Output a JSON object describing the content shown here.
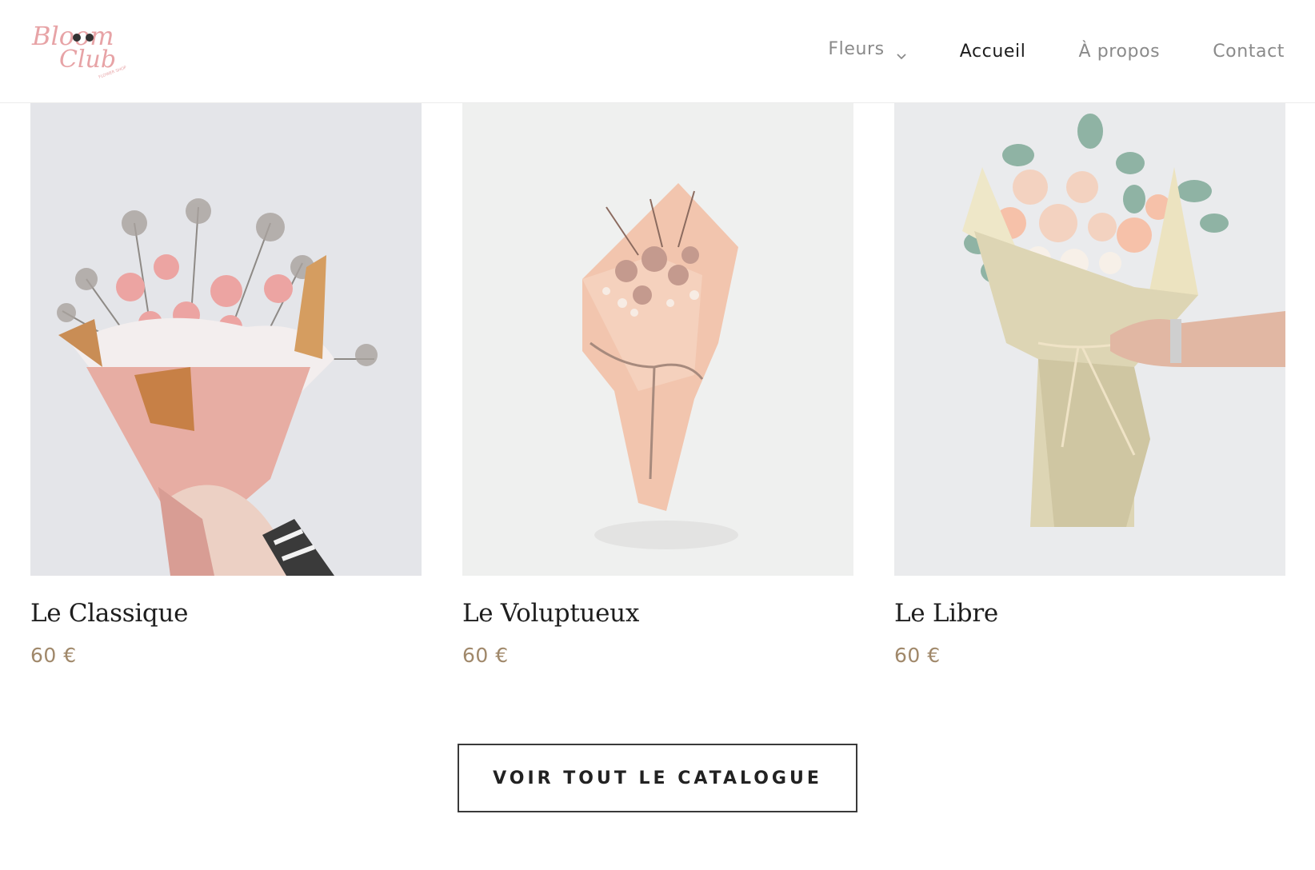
{
  "brand": {
    "logo_text_top": "Bloom",
    "logo_text_bottom": "Club",
    "logo_subtext": "FLOWER SHOP"
  },
  "nav": {
    "items": [
      {
        "label": "Fleurs",
        "has_dropdown": true
      },
      {
        "label": "Accueil",
        "active": true
      },
      {
        "label": "À propos"
      },
      {
        "label": "Contact"
      }
    ]
  },
  "products": [
    {
      "name": "Le Classique",
      "price": "60 €",
      "image": "bouquet-pink-carnations-kraft-paper"
    },
    {
      "name": "Le Voluptueux",
      "price": "60 €",
      "image": "bouquet-dried-flowers-peach-paper"
    },
    {
      "name": "Le Libre",
      "price": "60 €",
      "image": "bouquet-eucalyptus-roses-beige-wrap"
    }
  ],
  "cta": {
    "label": "VOIR TOUT LE CATALOGUE"
  },
  "colors": {
    "price": "#a0886a",
    "logo_pink": "#e7a3a6",
    "button_border": "#3a3a3a"
  }
}
